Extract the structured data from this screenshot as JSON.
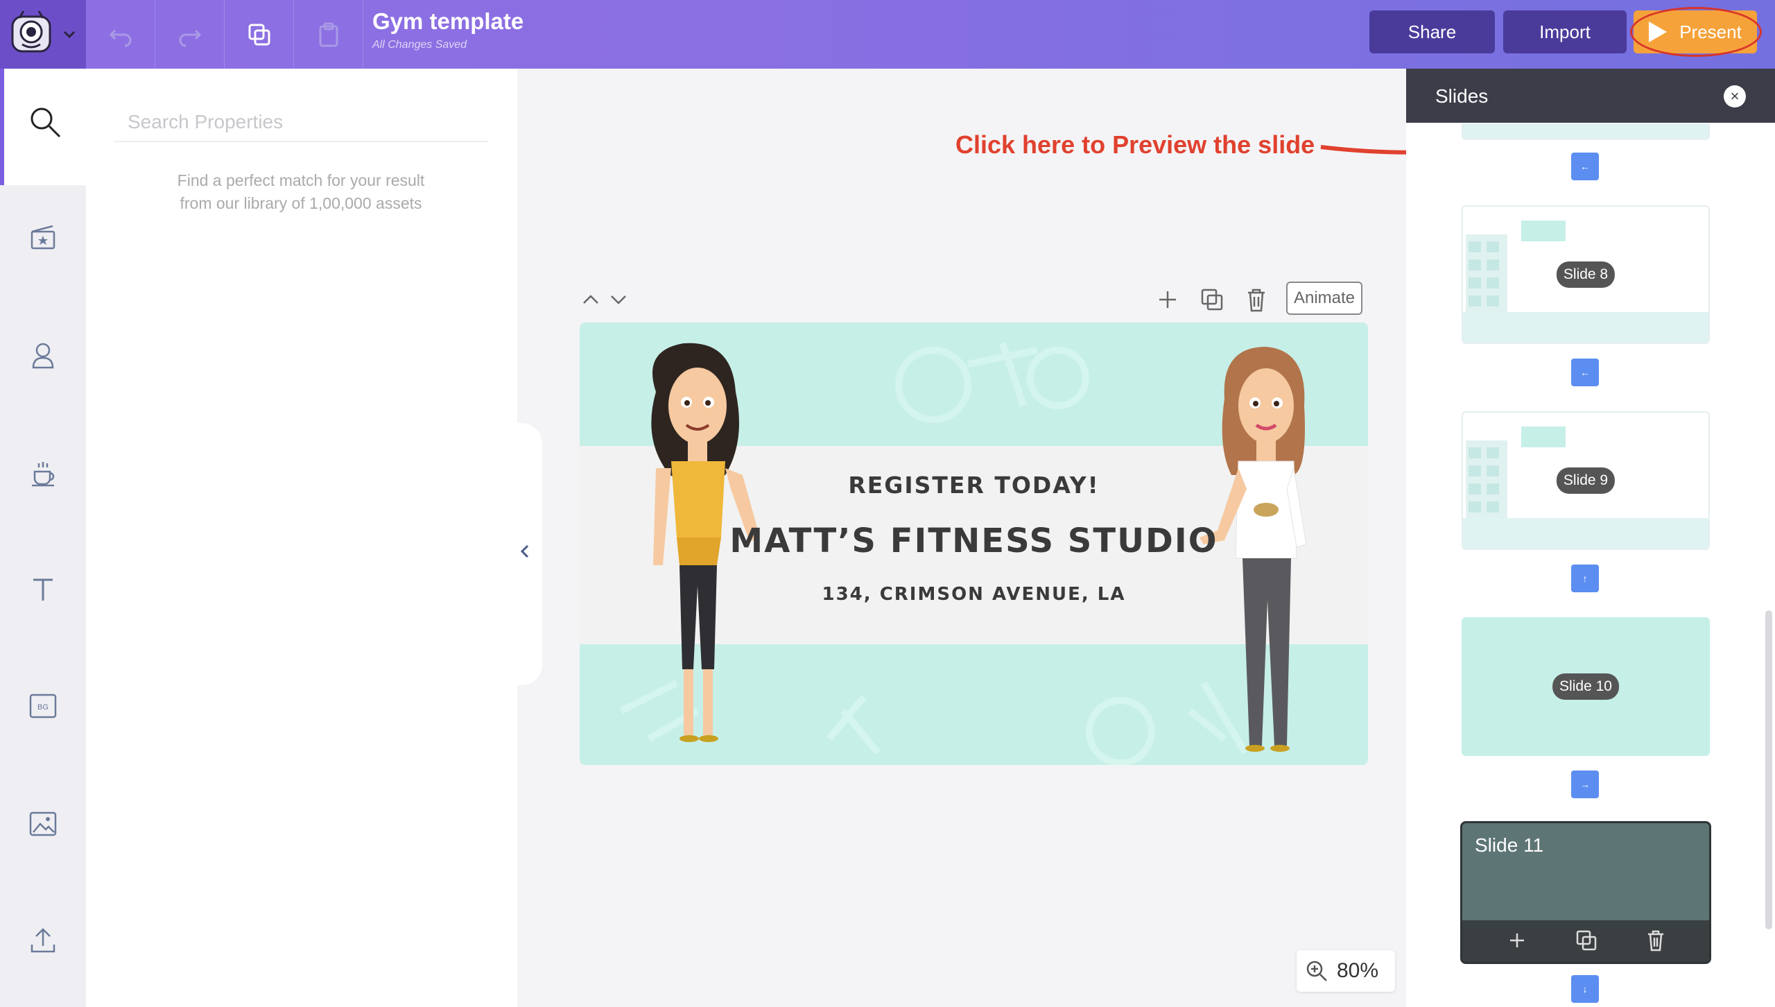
{
  "app": {
    "title": "Gym template",
    "status": "All Changes Saved"
  },
  "header": {
    "share_label": "Share",
    "import_label": "Import",
    "present_label": "Present"
  },
  "properties": {
    "search_placeholder": "Search Properties",
    "hint_line1": "Find a perfect match for your result",
    "hint_line2": "from our library of 1,00,000 assets"
  },
  "canvas": {
    "animate_label": "Animate",
    "zoom": "80%",
    "slide": {
      "line1": "REGISTER TODAY!",
      "line2": "MATT’S FITNESS STUDIO",
      "line3": "134, CRIMSON AVENUE, LA"
    }
  },
  "annotation": {
    "text": "Click here to Preview the slide",
    "color": "#e0412e"
  },
  "slides_panel": {
    "title": "Slides",
    "close_symbol": "×",
    "thumbnails": [
      {
        "label": "Slide 8"
      },
      {
        "label": "Slide 9"
      },
      {
        "label": "Slide 10"
      }
    ],
    "current": {
      "label": "Slide 11"
    },
    "transitions": [
      "←",
      "←",
      "↑",
      "→",
      "↓"
    ]
  },
  "colors": {
    "accent": "#7c5fe0",
    "present": "#f6a23a",
    "header_button": "#4a3b9b",
    "slide_teal": "#c6efe8"
  },
  "icons": {
    "rail": [
      "search-icon",
      "scene-icon",
      "character-icon",
      "props-icon",
      "text-icon",
      "background-icon",
      "image-icon",
      "upload-icon"
    ]
  }
}
